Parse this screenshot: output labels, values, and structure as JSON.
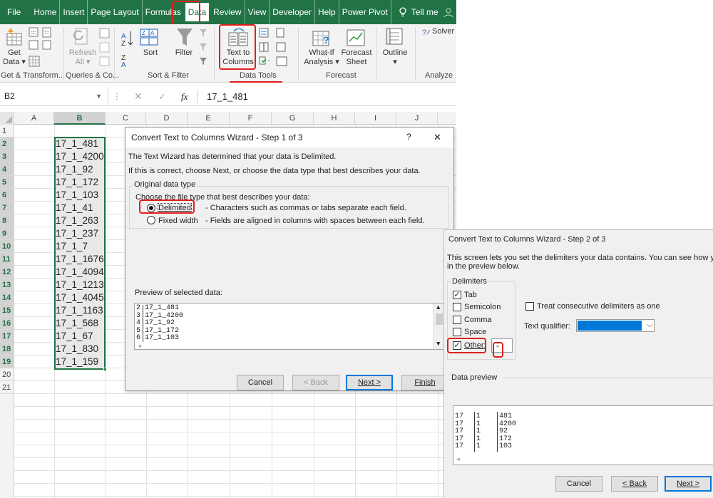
{
  "ribbon": {
    "tabs": [
      "File",
      "Home",
      "Insert",
      "Page Layout",
      "Formulas",
      "Data",
      "Review",
      "View",
      "Developer",
      "Help",
      "Power Pivot"
    ],
    "active_tab": "Data",
    "tell_me": "Tell me",
    "buttons": {
      "get_data": [
        "Get",
        "Data"
      ],
      "refresh_all": [
        "Refresh",
        "All"
      ],
      "sort": "Sort",
      "filter": "Filter",
      "text_to_columns": [
        "Text to",
        "Columns"
      ],
      "what_if": [
        "What-If",
        "Analysis"
      ],
      "forecast_sheet": [
        "Forecast",
        "Sheet"
      ],
      "outline": "Outline",
      "solver": "Solver"
    },
    "groups": [
      "Get & Transform...",
      "Queries & Co...",
      "Sort & Filter",
      "Data Tools",
      "Forecast",
      "Analyze"
    ]
  },
  "formula_bar": {
    "name_box": "B2",
    "fx": "fx",
    "value": "17_1_481"
  },
  "grid": {
    "columns": [
      "A",
      "B",
      "C",
      "D",
      "E",
      "F",
      "G",
      "H",
      "I",
      "J"
    ],
    "rows": [
      "1",
      "2",
      "3",
      "4",
      "5",
      "6",
      "7",
      "8",
      "9",
      "10",
      "11",
      "12",
      "13",
      "14",
      "15",
      "16",
      "17",
      "18",
      "19",
      "20",
      "21"
    ],
    "b_values": [
      "17_1_481",
      "17_1_4200",
      "17_1_92",
      "17_1_172",
      "17_1_103",
      "17_1_41",
      "17_1_263",
      "17_1_237",
      "17_1_7",
      "17_1_1676",
      "17_1_4094",
      "17_1_1213",
      "17_1_4045",
      "17_1_1163",
      "17_1_568",
      "17_1_67",
      "17_1_830",
      "17_1_159"
    ]
  },
  "wizard1": {
    "title": "Convert Text to Columns Wizard - Step 1 of 3",
    "help": "?",
    "close": "✕",
    "line1": "The Text Wizard has determined that your data is Delimited.",
    "line2": "If this is correct, choose Next, or choose the data type that best describes your data.",
    "group_label": "Original data type",
    "choose_label": "Choose the file type that best describes your data:",
    "opt_delimited": "Delimited",
    "opt_delimited_desc": "- Characters such as commas or tabs separate each field.",
    "opt_fixed": "Fixed width",
    "opt_fixed_desc": "- Fields are aligned in columns with spaces between each field.",
    "preview_label": "Preview of selected data:",
    "preview_lines": [
      "2 17_1_481",
      "3 17_1_4200",
      "4 17_1_92",
      "5 17_1_172",
      "6 17_1_103"
    ],
    "buttons": {
      "cancel": "Cancel",
      "back": "< Back",
      "next": "Next >",
      "finish": "Finish"
    }
  },
  "wizard2": {
    "title": "Convert Text to Columns Wizard - Step 2 of 3",
    "intro1": "This screen lets you set the delimiters your data contains.  You can see how your",
    "intro2": "in the preview below.",
    "delimiters_label": "Delimiters",
    "delims": [
      {
        "label": "Tab",
        "checked": true
      },
      {
        "label": "Semicolon",
        "checked": false
      },
      {
        "label": "Comma",
        "checked": false
      },
      {
        "label": "Space",
        "checked": false
      },
      {
        "label": "Other:",
        "checked": true
      }
    ],
    "other_value": "-",
    "consecutive": "Treat consecutive delimiters as one",
    "qualifier_label": "Text qualifier:",
    "data_preview_label": "Data preview",
    "preview_rows": [
      [
        "17",
        "1",
        "481"
      ],
      [
        "17",
        "1",
        "4200"
      ],
      [
        "17",
        "1",
        "92"
      ],
      [
        "17",
        "1",
        "172"
      ],
      [
        "17",
        "1",
        "103"
      ]
    ],
    "buttons": {
      "cancel": "Cancel",
      "back": "< Back",
      "next": "Next >"
    }
  }
}
